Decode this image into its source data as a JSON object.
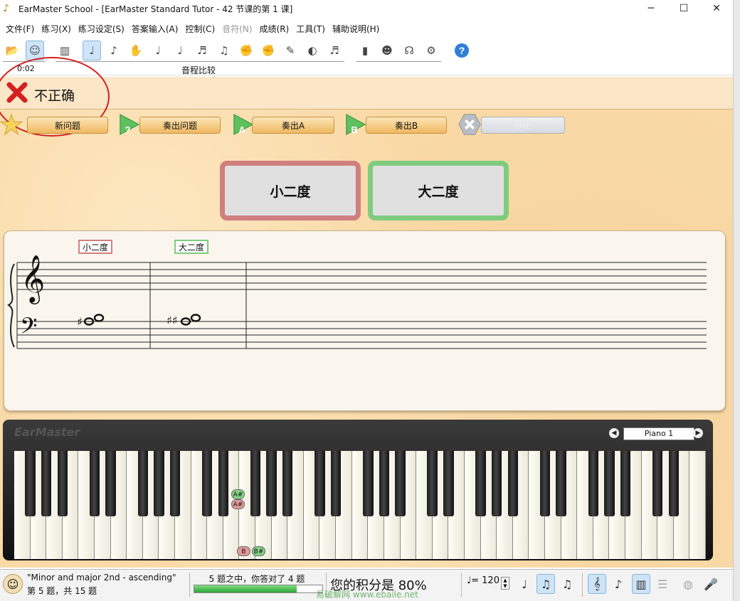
{
  "window": {
    "title": "EarMaster School - [EarMaster Standard Tutor - 42 节课的第 1 课]"
  },
  "menu": {
    "items": [
      {
        "label": "文件(F)",
        "enabled": true
      },
      {
        "label": "练习(X)",
        "enabled": true
      },
      {
        "label": "练习设定(S)",
        "enabled": true
      },
      {
        "label": "答案输入(A)",
        "enabled": true
      },
      {
        "label": "控制(C)",
        "enabled": true
      },
      {
        "label": "音符(N)",
        "enabled": false
      },
      {
        "label": "成绩(R)",
        "enabled": true
      },
      {
        "label": "工具(T)",
        "enabled": true
      },
      {
        "label": "辅助说明(H)",
        "enabled": true
      }
    ]
  },
  "toolbar": {
    "timer": "0:02",
    "exercise_label": "音程比较",
    "icons": [
      "open-icon",
      "tutor-face-icon",
      "book-icon",
      "interval-comparison-icon",
      "interval-identification-icon",
      "ear-hand-icon",
      "chord-identification-icon",
      "chord-inversion-icon",
      "scale-icon",
      "melody-icon",
      "hand-rhythm-icon",
      "hand-rhythm-2-icon",
      "rhythm-dictation-icon",
      "ear-rhythm-icon",
      "melody-dictation-icon",
      "statistics-icon",
      "student-icon",
      "headphones-icon",
      "settings-icon",
      "help-icon"
    ]
  },
  "feedback": {
    "text": "不正确",
    "status_color": "#d42020"
  },
  "actions": {
    "new_question": "新问题",
    "play_question": "奏出问题",
    "play_a": "奏出A",
    "play_b": "奏出B",
    "stop": "停止"
  },
  "answers": [
    {
      "label": "小二度",
      "border_color": "#d07f80",
      "state": "wrong"
    },
    {
      "label": "大二度",
      "border_color": "#7fcc7f",
      "state": "correct"
    }
  ],
  "score": {
    "labels": [
      "小二度",
      "大二度"
    ],
    "measure1_accidental": "♯",
    "measure2_accidentals": "♯♯"
  },
  "piano": {
    "brand": "EarMaster",
    "instrument": "Piano 1",
    "tags": [
      {
        "label": "A#",
        "color": "#86d486"
      },
      {
        "label": "A#",
        "color": "#e49a9a"
      },
      {
        "label": "B",
        "color": "#e49a9a"
      },
      {
        "label": "B#",
        "color": "#86d486"
      }
    ]
  },
  "status": {
    "lesson_name": "\"Minor and major 2nd - ascending\"",
    "question_count": "第 5 题，共 15 题",
    "progress_text": "5 题之中，你答对了 4 题",
    "progress_fraction": 0.8,
    "score_text": "您的积分是 80%",
    "watermark": "易破解网 www.ebaile.net",
    "tempo": "= 120"
  }
}
